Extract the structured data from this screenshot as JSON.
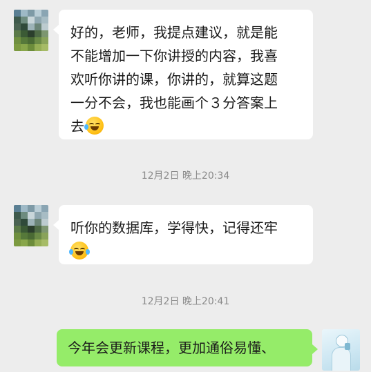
{
  "messages": [
    {
      "sender": "other",
      "lines": [
        "好的，老师，我提点建议，就是能",
        "不能增加一下你讲授的内容，我喜",
        "欢听你讲的课，你讲的，就算这题",
        "一分不会，我也能画个３分答案上",
        "去"
      ],
      "emoji": "laughing-crying-emoji"
    },
    {
      "sender": "other",
      "lines": [
        "听你的数据库，学得快，记得还牢"
      ],
      "emoji": "tears-of-joy-emoji"
    },
    {
      "sender": "self",
      "lines": [
        "今年会更新课程，更加通俗易懂、"
      ]
    }
  ],
  "timestamps": [
    "12月2日 晚上20:34",
    "12月2日 晚上20:41"
  ],
  "colors": {
    "background": "#ededed",
    "other_bubble": "#ffffff",
    "self_bubble": "#95ec69",
    "timestamp_text": "#8a8a8a"
  }
}
